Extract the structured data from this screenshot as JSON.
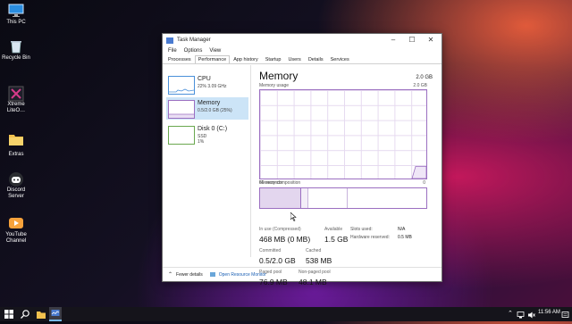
{
  "desktop": {
    "icons": [
      {
        "label": "This PC",
        "icon": "monitor-icon"
      },
      {
        "label": "Recycle Bin",
        "icon": "recycle-bin-icon"
      },
      {
        "label": "Xtreme LiteO…",
        "icon": "xtreme-app-icon"
      },
      {
        "label": "Extras",
        "icon": "folder-icon"
      },
      {
        "label": "Discord Server",
        "icon": "discord-icon"
      },
      {
        "label": "YouTube Channel",
        "icon": "youtube-icon"
      }
    ]
  },
  "window": {
    "title": "Task Manager",
    "menu": [
      "File",
      "Options",
      "View"
    ],
    "tabs": [
      "Processes",
      "Performance",
      "App history",
      "Startup",
      "Users",
      "Details",
      "Services"
    ],
    "active_tab": "Performance",
    "side_items": [
      {
        "name": "CPU",
        "sub1": "22%  3.09 GHz",
        "sub2": ""
      },
      {
        "name": "Memory",
        "sub1": "0.5/2.0 GB (25%)",
        "sub2": ""
      },
      {
        "name": "Disk 0 (C:)",
        "sub1": "SSD",
        "sub2": "1%"
      }
    ],
    "heading": "Memory",
    "total": "2.0 GB",
    "graph": {
      "label": "Memory usage",
      "max_label": "2.0 GB",
      "time_label": "60 seconds",
      "zero_label": "0",
      "usage_fraction": 0.25
    },
    "composition_label": "Memory composition",
    "stats": {
      "in_use_label": "In use (Compressed)",
      "in_use_value": "468 MB (0 MB)",
      "available_label": "Available",
      "available_value": "1.5 GB",
      "committed_label": "Committed",
      "committed_value": "0.5/2.0 GB",
      "cached_label": "Cached",
      "cached_value": "538 MB",
      "paged_label": "Paged pool",
      "paged_value": "76.9 MB",
      "nonpaged_label": "Non-paged pool",
      "nonpaged_value": "48.1 MB",
      "slots_label": "Slots used:",
      "slots_value": "N/A",
      "hw_label": "Hardware reserved:",
      "hw_value": "0.5 MB"
    },
    "footer": {
      "fewer": "Fewer details",
      "monitor": "Open Resource Monitor"
    }
  },
  "taskbar": {
    "time": "11:56 AM"
  },
  "colors": {
    "memory_accent": "#9b6fc1",
    "cpu_accent": "#4a90d9",
    "disk_accent": "#6aa84f",
    "selected_bg": "#cce4f7"
  }
}
